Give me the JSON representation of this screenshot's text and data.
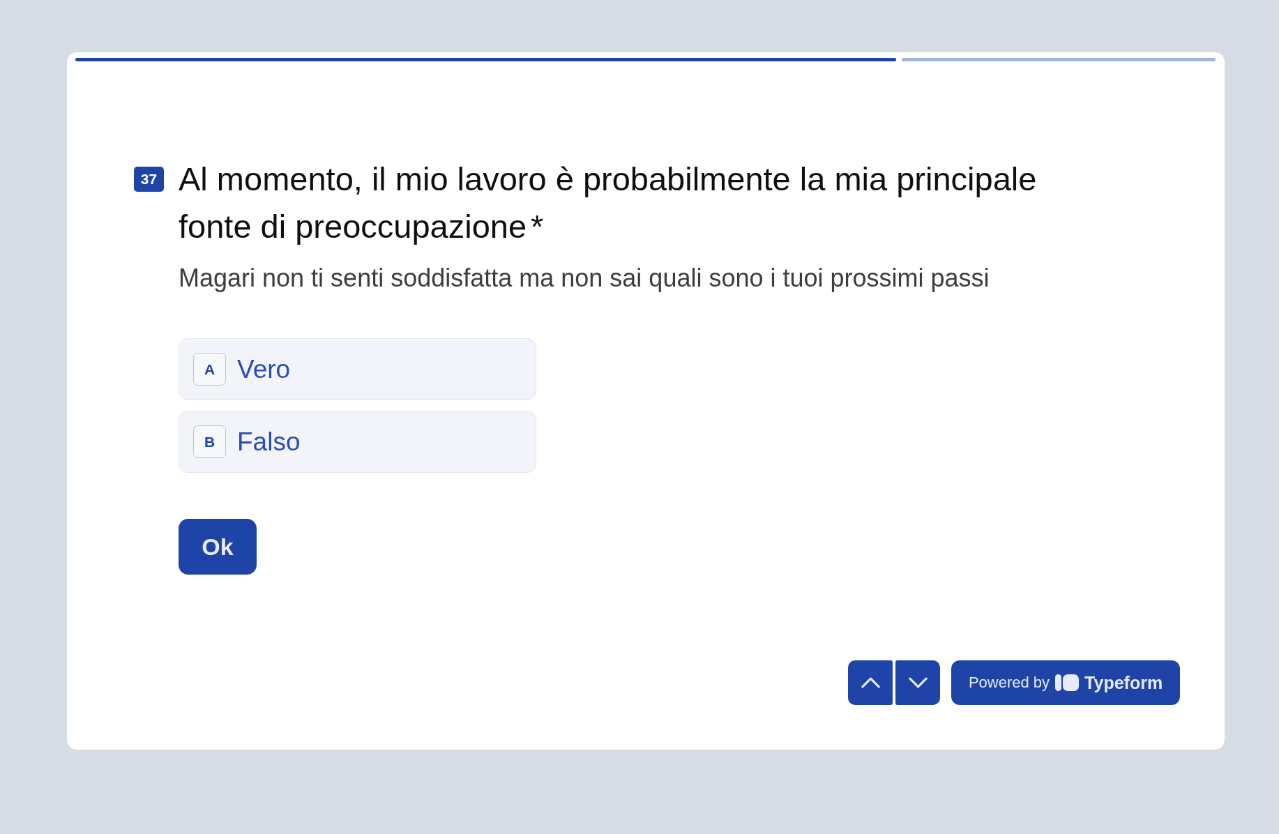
{
  "progress": {
    "level": 0.72
  },
  "question": {
    "number": "37",
    "title": "Al momento, il mio lavoro è probabilmente la mia principale fonte di preoccupazione",
    "required_mark": "*",
    "description": "Magari non ti senti soddisfatta ma non sai quali sono i tuoi prossimi passi"
  },
  "choices": [
    {
      "key": "A",
      "label": "Vero",
      "selected": false
    },
    {
      "key": "B",
      "label": "Falso",
      "selected": false
    }
  ],
  "submit_button": {
    "label": "Ok"
  },
  "navigation": [
    {
      "kind": "up"
    },
    {
      "kind": "down"
    }
  ],
  "branding": {
    "prefix": "Powered by",
    "brand": "Typeform"
  }
}
